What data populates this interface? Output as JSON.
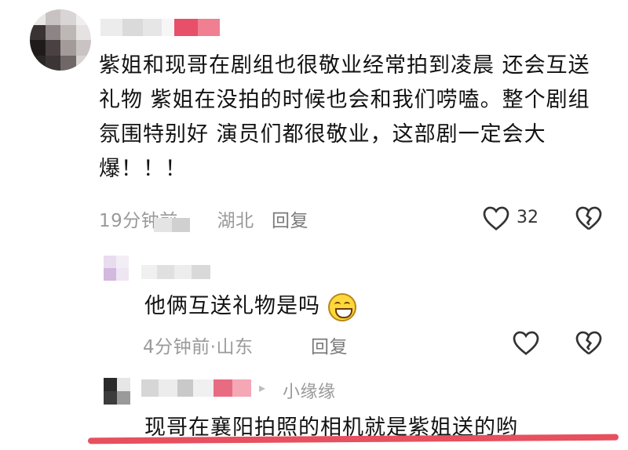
{
  "comment": {
    "text": "紫姐和现哥在剧组也很敬业经常拍到凌晨 还会互送礼物 紫姐在没拍的时候也会和我们唠嗑。整个剧组氛围特别好 演员们都很敬业，这部剧一定会大爆！！！",
    "time": "19分钟前",
    "location": "湖北",
    "reply_label": "回复",
    "like_count": "32"
  },
  "replies": [
    {
      "text": "他俩互送礼物是吗",
      "emoji": "grinning-face",
      "time": "4分钟前",
      "location": "山东",
      "reply_label": "回复"
    },
    {
      "reply_to": "小缘缘",
      "text": "现哥在襄阳拍照的相机就是紫姐送的哟"
    }
  ],
  "colors": {
    "highlight_underline": "#e7505f",
    "meta_gray": "#9a9a9a"
  }
}
